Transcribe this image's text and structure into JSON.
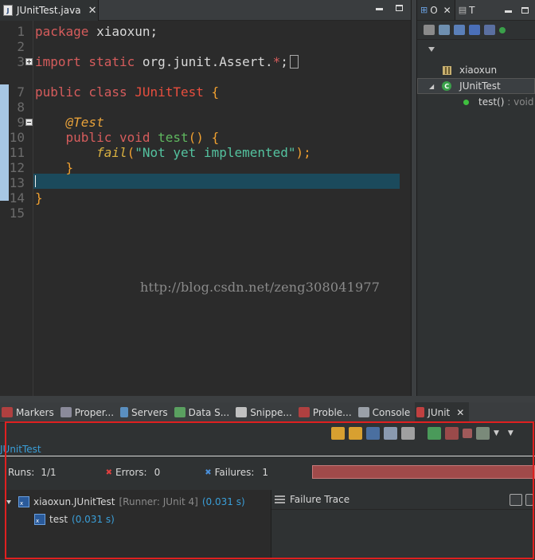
{
  "editor": {
    "tab_label": "JUnitTest.java",
    "tab_close": "✕",
    "lines": [
      {
        "n": "1"
      },
      {
        "n": "2"
      },
      {
        "n": "3"
      },
      {
        "n": "7"
      },
      {
        "n": "8"
      },
      {
        "n": "9"
      },
      {
        "n": "10"
      },
      {
        "n": "11"
      },
      {
        "n": "12"
      },
      {
        "n": "13"
      },
      {
        "n": "14"
      },
      {
        "n": "15"
      }
    ],
    "code": {
      "package_kw": "package",
      "package_name": " xiaoxun;",
      "import_kw": "import",
      "static_kw": " static",
      "import_path": " org.junit.Assert.",
      "import_star": "*",
      "import_semi": ";",
      "public_kw": "public",
      "class_kw": " class",
      "class_name": " JUnitTest",
      "open_brace": " {",
      "annotation": "@Test",
      "void_kw": " void",
      "method_name": " test",
      "parens": "()",
      "fail_call": "fail",
      "open_paren": "(",
      "message": "\"Not yet implemented\"",
      "close_stmt": ");",
      "close_brace": "}"
    },
    "watermark": "http://blog.csdn.net/zeng308041977"
  },
  "outline": {
    "tabs": [
      {
        "label": "O",
        "close": "✕"
      },
      {
        "label": "T"
      }
    ],
    "tree": [
      {
        "label": "xiaoxun"
      },
      {
        "label": "JUnitTest"
      },
      {
        "label": "test()",
        "suffix": " : void"
      }
    ]
  },
  "bottom": {
    "tabs": [
      {
        "label": "Markers"
      },
      {
        "label": "Proper..."
      },
      {
        "label": "Servers"
      },
      {
        "label": "Data S..."
      },
      {
        "label": "Snippe..."
      },
      {
        "label": "Proble..."
      },
      {
        "label": "Console"
      },
      {
        "label": "JUnit",
        "close": "✕"
      }
    ],
    "junit": {
      "title": "JUnitTest",
      "runs_label": "Runs:",
      "runs_value": "1/1",
      "errors_label": "Errors:",
      "errors_value": "0",
      "failures_label": "Failures:",
      "failures_value": "1",
      "progress_fraction": 1.0,
      "status_color": "#a04a4a",
      "suite_name": "xiaoxun.JUnitTest",
      "suite_runner": "[Runner: JUnit 4]",
      "suite_time": "(0.031 s)",
      "test_name": "test",
      "test_time": "(0.031 s)",
      "failure_trace_label": "Failure Trace"
    }
  }
}
